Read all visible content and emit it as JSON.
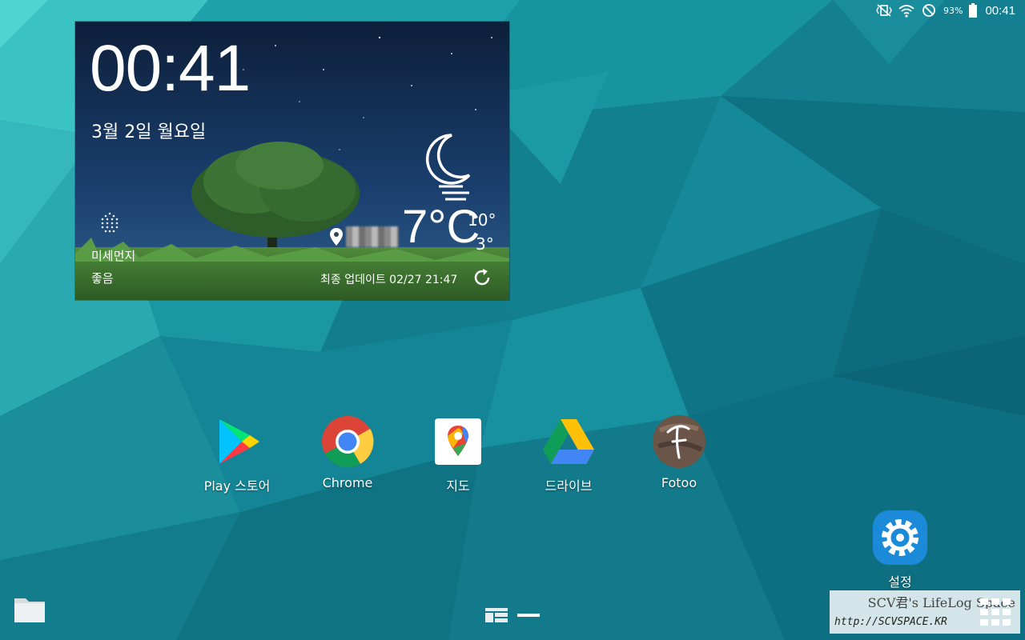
{
  "status_bar": {
    "battery_percent": "93%",
    "time": "00:41",
    "icons": [
      "vibrate-mute-icon",
      "wifi-icon",
      "no-sign-icon",
      "battery-icon"
    ]
  },
  "weather_widget": {
    "clock": "00:41",
    "date": "3월 2일 월요일",
    "fine_dust_label": "미세먼지",
    "fine_dust_value": "좋음",
    "temperature": "7°C",
    "high": "10°",
    "low": "3°",
    "last_updated": "최종 업데이트 02/27 21:47",
    "condition_icon": "moon-mist-icon"
  },
  "apps": [
    {
      "label": "Play 스토어",
      "icon": "play-store-icon"
    },
    {
      "label": "Chrome",
      "icon": "chrome-icon"
    },
    {
      "label": "지도",
      "icon": "maps-icon"
    },
    {
      "label": "드라이브",
      "icon": "drive-icon"
    },
    {
      "label": "Fotoo",
      "icon": "fotoo-icon"
    },
    {
      "label": "설정",
      "icon": "settings-icon"
    }
  ],
  "watermark": {
    "title": "SCV君's LifeLog Space",
    "url": "http://SCVSPACE.KR"
  },
  "colors": {
    "wallpaper_base": "#117f8e",
    "wallpaper_light": "#3fc6c8",
    "settings_icon": "#1a8ad9"
  }
}
